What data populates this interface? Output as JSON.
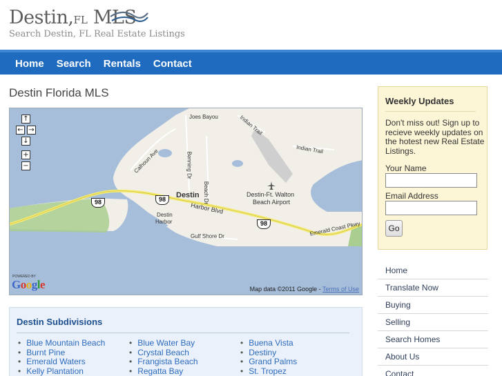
{
  "header": {
    "logo_main": "Destin,",
    "logo_fl": "FL",
    "logo_mls": " MLS",
    "tagline": "Search Destin, FL Real Estate Listings"
  },
  "nav": [
    {
      "label": "Home"
    },
    {
      "label": "Search"
    },
    {
      "label": "Rentals"
    },
    {
      "label": "Contact"
    }
  ],
  "main": {
    "title": "Destin Florida MLS",
    "map": {
      "labels": {
        "joes_bayou": "Joes Bayou",
        "indian_trail_1": "Indian Trail",
        "indian_trail_2": "Indian Trail",
        "calhoun": "Calhoun Ave",
        "benning": "Benning Dr",
        "beach_dr": "Beach Dr",
        "destin": "Destin",
        "airport": "Destin-Ft. Walton",
        "airport2": "Beach Airport",
        "harbor_blvd": "Harbor Blvd",
        "destin_harbor": "Destin",
        "destin_harbor2": "Harbor",
        "gulf_shore": "Gulf Shore Dr",
        "emerald_coast": "Emerald Coast Pkwy"
      },
      "shield_number": "98",
      "powered_by": "POWERED BY",
      "google": "Google",
      "attribution": "Map data ©2011 Google - ",
      "terms": "Terms of Use"
    },
    "subdivisions": {
      "title": "Destin Subdivisions",
      "col1": [
        "Blue Mountain Beach",
        "Burnt Pine",
        "Emerald Waters",
        "Kelly Plantation"
      ],
      "col2": [
        "Blue Water Bay",
        "Crystal Beach",
        "Frangista Beach",
        "Regatta Bay"
      ],
      "col3": [
        "Buena Vista",
        "Destiny",
        "Grand Palms",
        "St. Tropez"
      ]
    }
  },
  "sidebar": {
    "weekly": {
      "title": "Weekly Updates",
      "desc": "Don't miss out! Sign up to recieve weekly updates on the hotest new Real Estate Listings.",
      "name_label": "Your Name",
      "email_label": "Email Address",
      "go": "Go"
    },
    "links": [
      {
        "label": "Home"
      },
      {
        "label": "Translate Now"
      },
      {
        "label": "Buying"
      },
      {
        "label": "Selling"
      },
      {
        "label": "Search Homes"
      },
      {
        "label": "About Us"
      },
      {
        "label": "Contact"
      }
    ]
  }
}
